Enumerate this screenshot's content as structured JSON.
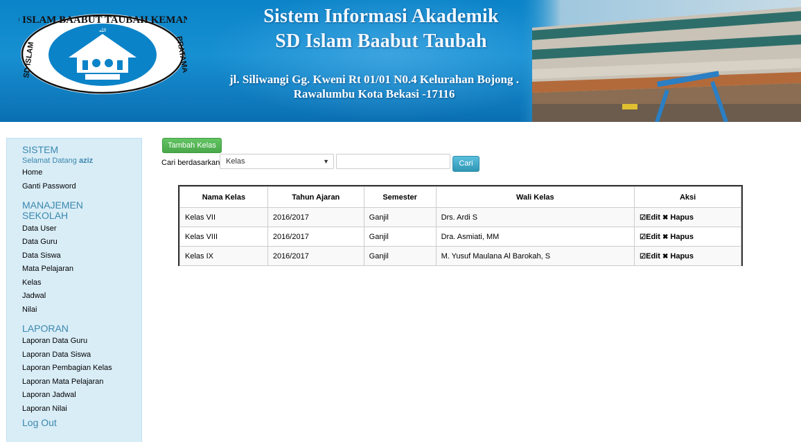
{
  "header": {
    "title_line1": "Sistem Informasi Akademik",
    "title_line2": "SD Islam Baabut Taubah",
    "address_line1": "jl. Siliwangi Gg. Kweni Rt 01/01 N0.4 Kelurahan Bojong .",
    "address_line2": "Rawalumbu Kota Bekasi -17116",
    "logo_text": "SD ISLAM BAABUT TAUBAH KEMANG PRATAMA"
  },
  "sidebar": {
    "sistem": {
      "heading": "SISTEM",
      "welcome_prefix": "Selamat Datang",
      "username": "aziz",
      "items": [
        "Home",
        "Ganti Password"
      ]
    },
    "manajemen": {
      "heading_line1": "MANAJEMEN",
      "heading_line2": "SEKOLAH",
      "items": [
        "Data User",
        "Data Guru",
        "Data Siswa",
        "Mata Pelajaran",
        "Kelas",
        "Jadwal",
        "Nilai"
      ]
    },
    "laporan": {
      "heading": "LAPORAN",
      "items": [
        "Laporan Data Guru",
        "Laporan Data Siswa",
        "Laporan Pembagian Kelas",
        "Laporan Mata Pelajaran",
        "Laporan Jadwal",
        "Laporan Nilai"
      ]
    },
    "logout_label": "Log Out"
  },
  "toolbar": {
    "add_label": "Tambah Kelas",
    "search_label": "Cari berdasarkan",
    "search_select_value": "Kelas",
    "search_input_value": "",
    "search_button_label": "Cari"
  },
  "table": {
    "headers": [
      "Nama Kelas",
      "Tahun Ajaran",
      "Semester",
      "Wali Kelas",
      "Aksi"
    ],
    "rows": [
      [
        "Kelas VII",
        "2016/2017",
        "Ganjil",
        "Drs. Ardi S"
      ],
      [
        "Kelas VIII",
        "2016/2017",
        "Ganjil",
        "Dra. Asmiati, MM"
      ],
      [
        "Kelas IX",
        "2016/2017",
        "Ganjil",
        "M. Yusuf Maulana Al Barokah, S"
      ]
    ],
    "edit_label": "Edit",
    "delete_label": "Hapus",
    "edit_icon": "edit-icon",
    "delete_icon": "remove-icon"
  },
  "colors": {
    "header_blue": "#1790d2",
    "sidebar_bg": "#d9edf7",
    "sidebar_heading": "#3a87ad",
    "add_button": "#5cb85c",
    "search_button": "#46b8da"
  }
}
